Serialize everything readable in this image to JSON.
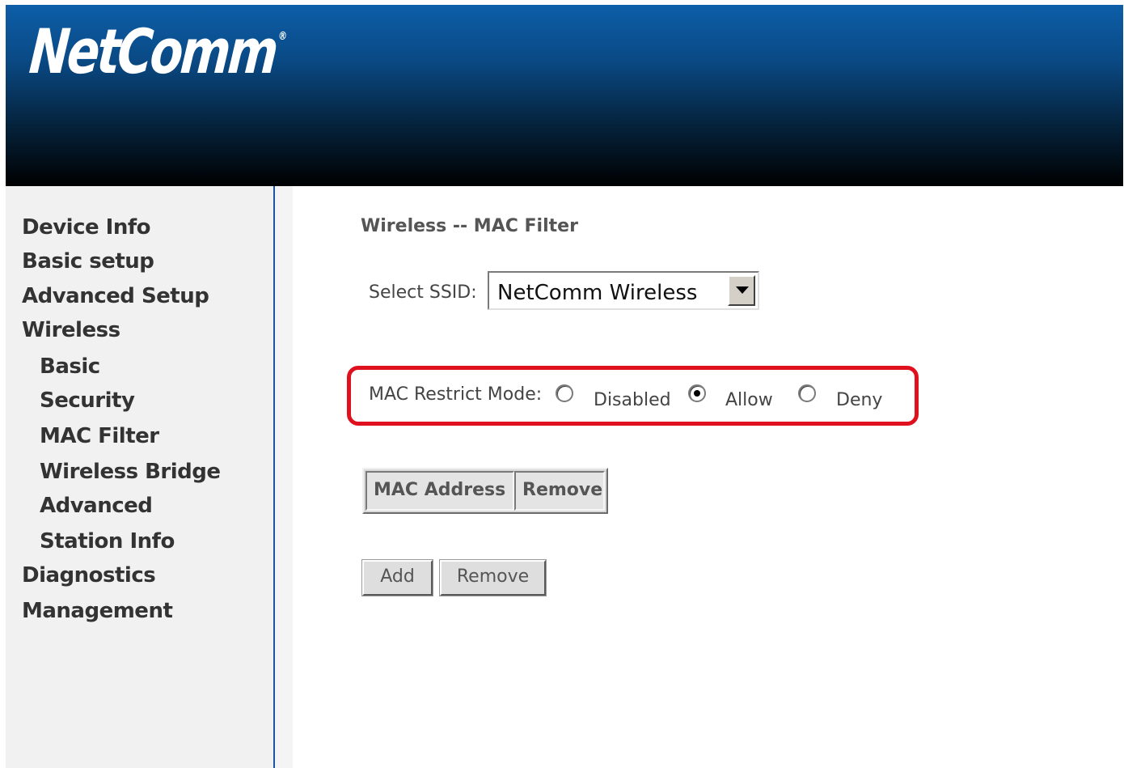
{
  "header": {
    "logo_text": "NetComm",
    "logo_mark": "®"
  },
  "sidebar": {
    "items": [
      {
        "label": "Device Info"
      },
      {
        "label": "Basic setup"
      },
      {
        "label": "Advanced Setup"
      },
      {
        "label": "Wireless"
      },
      {
        "label": "Basic"
      },
      {
        "label": "Security"
      },
      {
        "label": "MAC Filter"
      },
      {
        "label": "Wireless Bridge"
      },
      {
        "label": "Advanced"
      },
      {
        "label": "Station Info"
      },
      {
        "label": "Diagnostics"
      },
      {
        "label": "Management"
      }
    ]
  },
  "main": {
    "title": "Wireless -- MAC Filter",
    "ssid": {
      "label": "Select SSID:",
      "value": "NetComm Wireless"
    },
    "restrict_mode": {
      "label": "MAC Restrict Mode:",
      "options": [
        {
          "label": "Disabled",
          "checked": false
        },
        {
          "label": "Allow",
          "checked": true
        },
        {
          "label": "Deny",
          "checked": false
        }
      ],
      "highlight_color": "#e0111f"
    },
    "table": {
      "columns": [
        "MAC Address",
        "Remove"
      ],
      "rows": []
    },
    "buttons": {
      "add": "Add",
      "remove": "Remove"
    }
  },
  "colors": {
    "header_top": "#0d5ea8",
    "header_bottom": "#000000",
    "sidebar_border": "#1c55a8"
  }
}
